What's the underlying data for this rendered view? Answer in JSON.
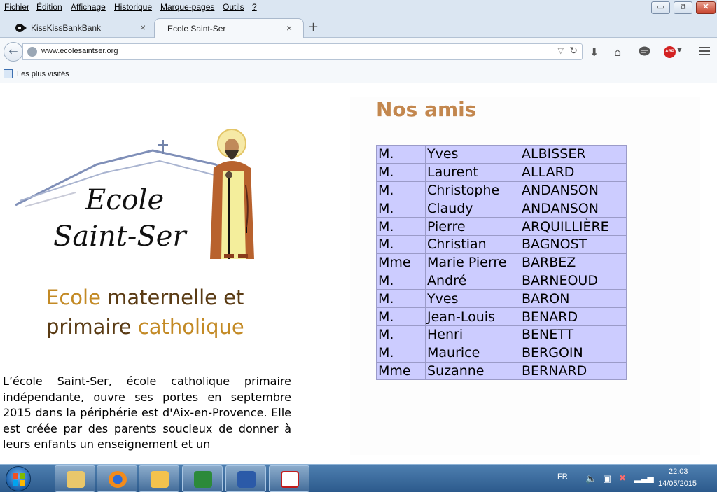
{
  "menubar": {
    "items": [
      "Fichier",
      "Édition",
      "Affichage",
      "Historique",
      "Marque-pages",
      "Outils",
      "?"
    ]
  },
  "window_controls": {
    "minimize": "▭",
    "maximize": "⧉",
    "close": "✕"
  },
  "tabs": [
    {
      "label": "KissKissBankBank",
      "active": false
    },
    {
      "label": "Ecole Saint-Ser",
      "active": true
    }
  ],
  "tab_close_glyph": "×",
  "new_tab_glyph": "+",
  "address_bar": {
    "url": "www.ecolesaintser.org"
  },
  "bookmarks": {
    "label": "Les plus visités"
  },
  "page": {
    "logo": {
      "line1": "Ecole",
      "line2": "Saint-Ser"
    },
    "tagline": {
      "part1": "Ecole",
      "part2": " maternelle et",
      "part3": "primaire ",
      "part4": "catholique"
    },
    "intro": "L’école Saint-Ser, école catholique primaire indépendante, ouvre ses portes en septembre 2015 dans la périphérie est d'Aix-en-Provence. Elle est créée par des parents soucieux de donner à leurs enfants un enseignement et un",
    "heading": "Nos amis",
    "friends": [
      [
        "M.",
        "Yves",
        "ALBISSER"
      ],
      [
        "M.",
        "Laurent",
        "ALLARD"
      ],
      [
        "M.",
        "Christophe",
        "ANDANSON"
      ],
      [
        "M.",
        "Claudy",
        "ANDANSON"
      ],
      [
        "M.",
        "Pierre",
        "ARQUILLIÈRE"
      ],
      [
        "M.",
        "Christian",
        "BAGNOST"
      ],
      [
        "Mme",
        "Marie Pierre",
        "BARBEZ"
      ],
      [
        "M.",
        "André",
        "BARNEOUD"
      ],
      [
        "M.",
        "Yves",
        "BARON"
      ],
      [
        "M.",
        "Jean-Louis",
        "BENARD"
      ],
      [
        "M.",
        "Henri",
        "BENETT"
      ],
      [
        "M.",
        "Maurice",
        "BERGOIN"
      ],
      [
        "Mme",
        "Suzanne",
        "BERNARD"
      ]
    ]
  },
  "taskbar": {
    "language": "FR",
    "time": "22:03",
    "date": "14/05/2015"
  },
  "colors": {
    "table_background": "#ccccff",
    "heading": "#c3874e",
    "tagline_gold": "#c38a25",
    "tagline_brown": "#5a3b14"
  }
}
